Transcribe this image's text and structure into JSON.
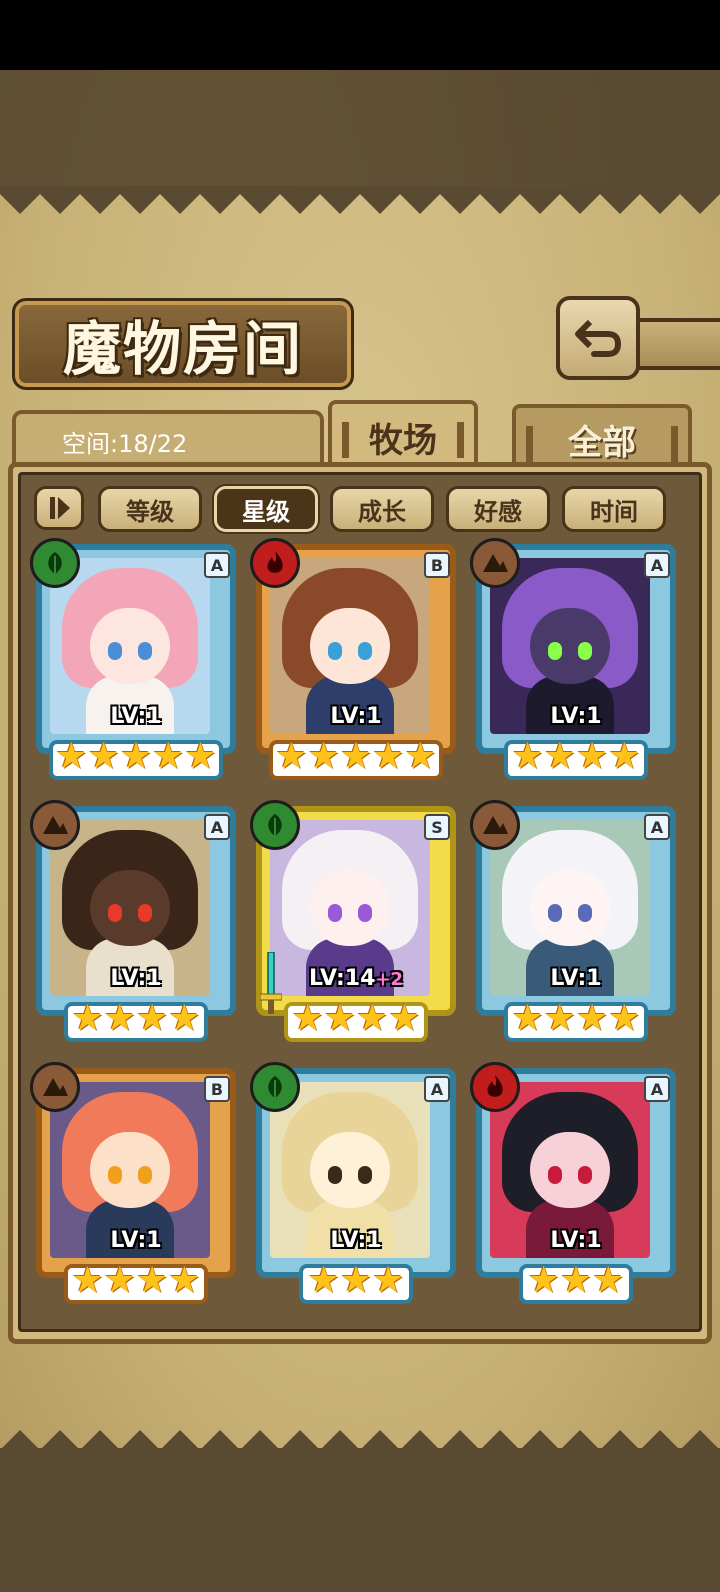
{
  "header": {
    "title": "魔物房间"
  },
  "space": {
    "label": "空间:18/22"
  },
  "tabs": [
    {
      "label": "牧场",
      "active": true
    },
    {
      "label": "全部",
      "active": false
    }
  ],
  "filters": [
    {
      "label": "等级",
      "selected": false
    },
    {
      "label": "星级",
      "selected": true
    },
    {
      "label": "成长",
      "selected": false
    },
    {
      "label": "好感",
      "selected": false
    },
    {
      "label": "时间",
      "selected": false
    }
  ],
  "monsters": [
    {
      "element": "leaf-icon",
      "rank": "A",
      "level": "LV:1",
      "plus": "",
      "stars": 5,
      "frame": "blue"
    },
    {
      "element": "fire-icon",
      "rank": "B",
      "level": "LV:1",
      "plus": "",
      "stars": 5,
      "frame": "orange"
    },
    {
      "element": "earth-icon",
      "rank": "A",
      "level": "LV:1",
      "plus": "",
      "stars": 4,
      "frame": "blue"
    },
    {
      "element": "earth-icon",
      "rank": "A",
      "level": "LV:1",
      "plus": "",
      "stars": 4,
      "frame": "blue"
    },
    {
      "element": "leaf-icon",
      "rank": "S",
      "level": "LV:14",
      "plus": "+2",
      "stars": 4,
      "frame": "gold"
    },
    {
      "element": "earth-icon",
      "rank": "A",
      "level": "LV:1",
      "plus": "",
      "stars": 4,
      "frame": "blue"
    },
    {
      "element": "earth-icon",
      "rank": "B",
      "level": "LV:1",
      "plus": "",
      "stars": 4,
      "frame": "orange"
    },
    {
      "element": "leaf-icon",
      "rank": "A",
      "level": "LV:1",
      "plus": "",
      "stars": 3,
      "frame": "blue"
    },
    {
      "element": "fire-icon",
      "rank": "A",
      "level": "LV:1",
      "plus": "",
      "stars": 3,
      "frame": "blue"
    }
  ],
  "colors": {
    "parchment": "#c6b075",
    "frame_brown": "#7a5a2c",
    "star": "#ffc21a"
  }
}
